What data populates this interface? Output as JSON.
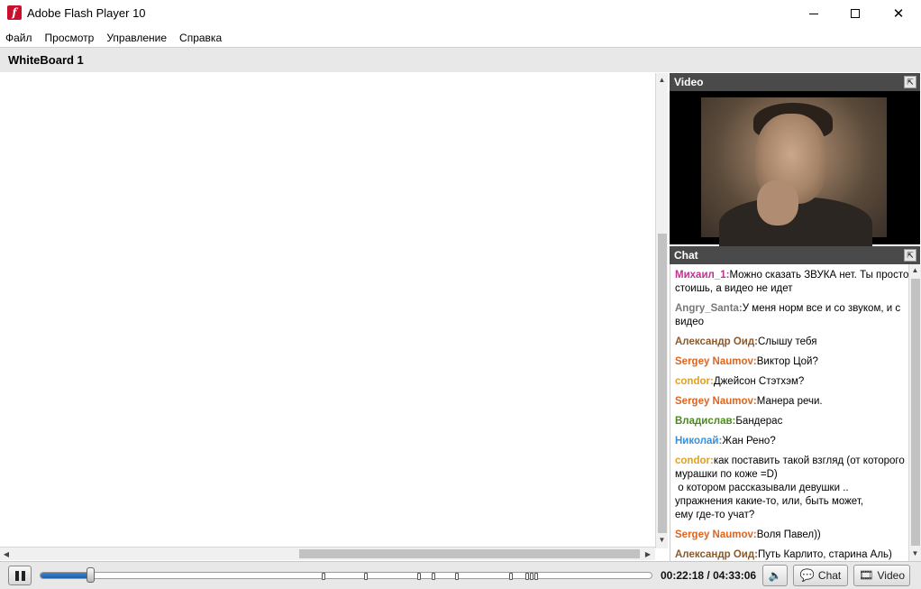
{
  "window": {
    "title": "Adobe Flash Player 10",
    "app_icon_glyph": "f"
  },
  "menu": {
    "items": [
      "Файл",
      "Просмотр",
      "Управление",
      "Справка"
    ]
  },
  "whiteboard": {
    "title": "WhiteBoard 1"
  },
  "video_panel": {
    "title": "Video"
  },
  "chat_panel": {
    "title": "Chat",
    "messages": [
      {
        "nick": "Михаил_1:",
        "text": "Можно сказать ЗВУКА нет. Ты просто стоишь, а видео не идет",
        "color": "#c0338f"
      },
      {
        "nick": "Angry_Santa:",
        "text": "У меня норм все и со звуком, и с видео",
        "color": "#777777"
      },
      {
        "nick": "Александр Оид:",
        "text": "Слышу тебя",
        "color": "#8b5a2b"
      },
      {
        "nick": "Sergey Naumov:",
        "text": "Виктор Цой?",
        "color": "#e0651e"
      },
      {
        "nick": "condor:",
        "text": "Джейсон Стэтхэм?",
        "color": "#e0a020"
      },
      {
        "nick": "Sergey Naumov:",
        "text": "Манера речи.",
        "color": "#e0651e"
      },
      {
        "nick": "Владислав:",
        "text": "Бандерас",
        "color": "#4a8a1c"
      },
      {
        "nick": "Николай:",
        "text": "Жан Рено?",
        "color": "#3a8fd6"
      },
      {
        "nick": "condor:",
        "text": "как поставить такой взгляд (от которого мурашки по коже =D)\n о котором рассказывали девушки ..\nупражнения какие-то, или, быть может,\nему где-то учат?\n",
        "color": "#e0a020"
      },
      {
        "nick": "Sergey Naumov:",
        "text": "Воля Павел))",
        "color": "#e0651e"
      },
      {
        "nick": "Александр Оид:",
        "text": "Путь Карлито, старина Аль)",
        "color": "#8b5a2b"
      }
    ]
  },
  "player": {
    "current_time": "00:22:18",
    "total_time": "04:33:06",
    "time_separator": " / ",
    "progress_fraction": 0.0817,
    "chat_button_label": "Chat",
    "video_button_label": "Video"
  },
  "icons": {
    "pause": "pause-icon",
    "volume": "speaker-icon",
    "chat": "speech-bubble-icon",
    "video": "film-icon"
  }
}
